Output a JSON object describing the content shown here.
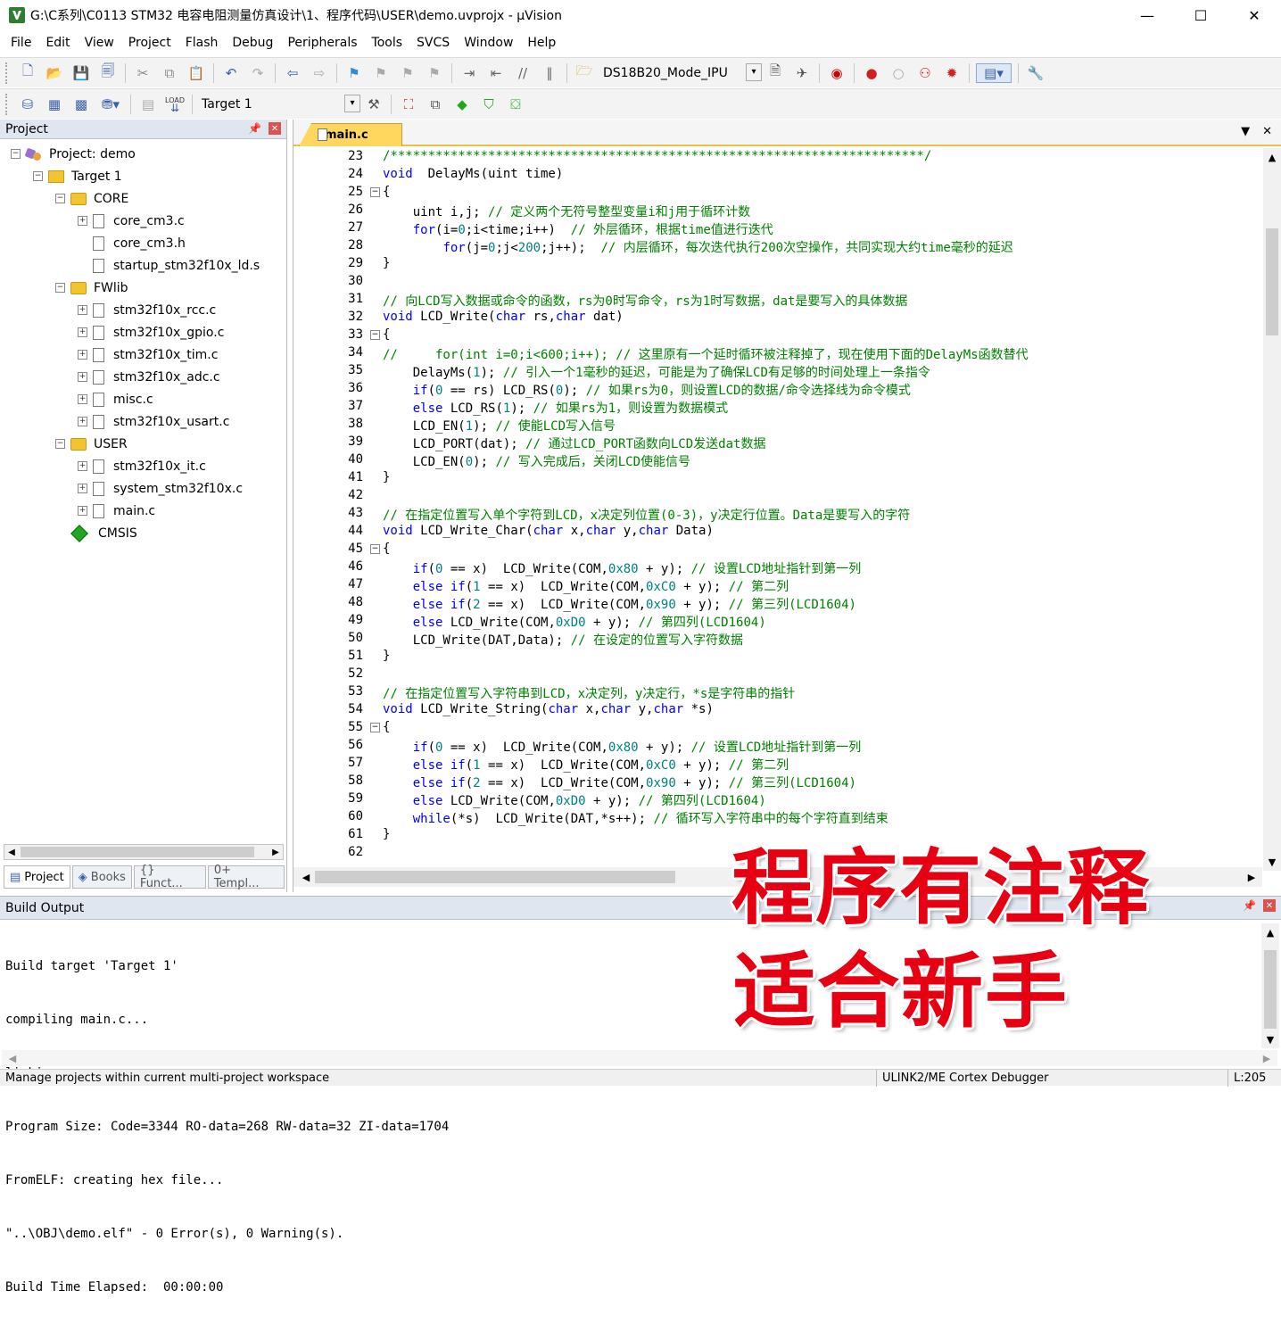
{
  "window": {
    "title": "G:\\C系列\\C0113 STM32 电容电阻测量仿真设计\\1、程序代码\\USER\\demo.uvprojx - µVision",
    "min": "—",
    "max": "☐",
    "close": "✕"
  },
  "menu": [
    "File",
    "Edit",
    "View",
    "Project",
    "Flash",
    "Debug",
    "Peripherals",
    "Tools",
    "SVCS",
    "Window",
    "Help"
  ],
  "toolbar": {
    "search_combo": "DS18B20_Mode_IPU",
    "target_combo": "Target 1",
    "load_label": "LOAD"
  },
  "project_panel": {
    "title": "Project",
    "root": "Project: demo",
    "target": "Target 1",
    "groups": [
      {
        "name": "CORE",
        "files": [
          "core_cm3.c",
          "core_cm3.h",
          "startup_stm32f10x_ld.s"
        ]
      },
      {
        "name": "FWlib",
        "files": [
          "stm32f10x_rcc.c",
          "stm32f10x_gpio.c",
          "stm32f10x_tim.c",
          "stm32f10x_adc.c",
          "misc.c",
          "stm32f10x_usart.c"
        ]
      },
      {
        "name": "USER",
        "files": [
          "stm32f10x_it.c",
          "system_stm32f10x.c",
          "main.c"
        ]
      }
    ],
    "cmsis": "CMSIS",
    "tabs": [
      "Project",
      "Books",
      "{} Funct...",
      "0+ Templ..."
    ]
  },
  "editor": {
    "tab": "main.c"
  },
  "code_lines": [
    {
      "n": "23",
      "fold": "",
      "parts": [
        [
          "cm",
          "/***********************************************************************/"
        ]
      ]
    },
    {
      "n": "24",
      "fold": "",
      "parts": [
        [
          "kw",
          "void"
        ],
        [
          "",
          "  DelayMs(uint time)"
        ]
      ]
    },
    {
      "n": "25",
      "fold": "-",
      "parts": [
        [
          "",
          "{"
        ]
      ]
    },
    {
      "n": "26",
      "fold": "",
      "parts": [
        [
          "",
          "    uint i,j; "
        ],
        [
          "cm",
          "// 定义两个无符号整型变量i和j用于循环计数"
        ]
      ]
    },
    {
      "n": "27",
      "fold": "",
      "parts": [
        [
          "",
          "    "
        ],
        [
          "kw",
          "for"
        ],
        [
          "",
          "(i="
        ],
        [
          "num",
          "0"
        ],
        [
          "",
          ";i<time;i++)  "
        ],
        [
          "cm",
          "// 外层循环，根据time值进行迭代"
        ]
      ]
    },
    {
      "n": "28",
      "fold": "",
      "parts": [
        [
          "",
          "        "
        ],
        [
          "kw",
          "for"
        ],
        [
          "",
          "(j="
        ],
        [
          "num",
          "0"
        ],
        [
          "",
          ";j<"
        ],
        [
          "num",
          "200"
        ],
        [
          "",
          ";j++);  "
        ],
        [
          "cm",
          "// 内层循环，每次迭代执行200次空操作，共同实现大约time毫秒的延迟"
        ]
      ]
    },
    {
      "n": "29",
      "fold": "",
      "parts": [
        [
          "",
          "}"
        ]
      ]
    },
    {
      "n": "30",
      "fold": "",
      "parts": [
        [
          "",
          ""
        ]
      ]
    },
    {
      "n": "31",
      "fold": "",
      "parts": [
        [
          "cm",
          "// 向LCD写入数据或命令的函数，rs为0时写命令，rs为1时写数据，dat是要写入的具体数据"
        ]
      ]
    },
    {
      "n": "32",
      "fold": "",
      "parts": [
        [
          "kw",
          "void"
        ],
        [
          "",
          " LCD_Write("
        ],
        [
          "kw",
          "char"
        ],
        [
          "",
          " rs,"
        ],
        [
          "kw",
          "char"
        ],
        [
          "",
          " dat)"
        ]
      ]
    },
    {
      "n": "33",
      "fold": "-",
      "parts": [
        [
          "",
          "{"
        ]
      ]
    },
    {
      "n": "34",
      "fold": "",
      "parts": [
        [
          "cm",
          "//     for(int i=0;i<600;i++); // 这里原有一个延时循环被注释掉了，现在使用下面的DelayMs函数替代"
        ]
      ]
    },
    {
      "n": "35",
      "fold": "",
      "parts": [
        [
          "",
          "    DelayMs("
        ],
        [
          "num",
          "1"
        ],
        [
          "",
          "); "
        ],
        [
          "cm",
          "// 引入一个1毫秒的延迟，可能是为了确保LCD有足够的时间处理上一条指令"
        ]
      ]
    },
    {
      "n": "36",
      "fold": "",
      "parts": [
        [
          "",
          "    "
        ],
        [
          "kw",
          "if"
        ],
        [
          "",
          "("
        ],
        [
          "num",
          "0"
        ],
        [
          "",
          " == rs) LCD_RS("
        ],
        [
          "num",
          "0"
        ],
        [
          "",
          "); "
        ],
        [
          "cm",
          "// 如果rs为0，则设置LCD的数据/命令选择线为命令模式"
        ]
      ]
    },
    {
      "n": "37",
      "fold": "",
      "parts": [
        [
          "",
          "    "
        ],
        [
          "kw",
          "else"
        ],
        [
          "",
          " LCD_RS("
        ],
        [
          "num",
          "1"
        ],
        [
          "",
          "); "
        ],
        [
          "cm",
          "// 如果rs为1，则设置为数据模式"
        ]
      ]
    },
    {
      "n": "38",
      "fold": "",
      "parts": [
        [
          "",
          "    LCD_EN("
        ],
        [
          "num",
          "1"
        ],
        [
          "",
          "); "
        ],
        [
          "cm",
          "// 使能LCD写入信号"
        ]
      ]
    },
    {
      "n": "39",
      "fold": "",
      "parts": [
        [
          "",
          "    LCD_PORT(dat); "
        ],
        [
          "cm",
          "// 通过LCD_PORT函数向LCD发送dat数据"
        ]
      ]
    },
    {
      "n": "40",
      "fold": "",
      "parts": [
        [
          "",
          "    LCD_EN("
        ],
        [
          "num",
          "0"
        ],
        [
          "",
          "); "
        ],
        [
          "cm",
          "// 写入完成后，关闭LCD使能信号"
        ]
      ]
    },
    {
      "n": "41",
      "fold": "",
      "parts": [
        [
          "",
          "}"
        ]
      ]
    },
    {
      "n": "42",
      "fold": "",
      "parts": [
        [
          "",
          ""
        ]
      ]
    },
    {
      "n": "43",
      "fold": "",
      "parts": [
        [
          "cm",
          "// 在指定位置写入单个字符到LCD，x决定列位置(0-3)，y决定行位置。Data是要写入的字符"
        ]
      ]
    },
    {
      "n": "44",
      "fold": "",
      "parts": [
        [
          "kw",
          "void"
        ],
        [
          "",
          " LCD_Write_Char("
        ],
        [
          "kw",
          "char"
        ],
        [
          "",
          " x,"
        ],
        [
          "kw",
          "char"
        ],
        [
          "",
          " y,"
        ],
        [
          "kw",
          "char"
        ],
        [
          "",
          " Data)"
        ]
      ]
    },
    {
      "n": "45",
      "fold": "-",
      "parts": [
        [
          "",
          "{"
        ]
      ]
    },
    {
      "n": "46",
      "fold": "",
      "parts": [
        [
          "",
          "    "
        ],
        [
          "kw",
          "if"
        ],
        [
          "",
          "("
        ],
        [
          "num",
          "0"
        ],
        [
          "",
          " == x)  LCD_Write(COM,"
        ],
        [
          "num",
          "0x80"
        ],
        [
          "",
          " + y); "
        ],
        [
          "cm",
          "// 设置LCD地址指针到第一列"
        ]
      ]
    },
    {
      "n": "47",
      "fold": "",
      "parts": [
        [
          "",
          "    "
        ],
        [
          "kw",
          "else if"
        ],
        [
          "",
          "("
        ],
        [
          "num",
          "1"
        ],
        [
          "",
          " == x)  LCD_Write(COM,"
        ],
        [
          "num",
          "0xC0"
        ],
        [
          "",
          " + y); "
        ],
        [
          "cm",
          "// 第二列"
        ]
      ]
    },
    {
      "n": "48",
      "fold": "",
      "parts": [
        [
          "",
          "    "
        ],
        [
          "kw",
          "else if"
        ],
        [
          "",
          "("
        ],
        [
          "num",
          "2"
        ],
        [
          "",
          " == x)  LCD_Write(COM,"
        ],
        [
          "num",
          "0x90"
        ],
        [
          "",
          " + y); "
        ],
        [
          "cm",
          "// 第三列(LCD1604)"
        ]
      ]
    },
    {
      "n": "49",
      "fold": "",
      "parts": [
        [
          "",
          "    "
        ],
        [
          "kw",
          "else"
        ],
        [
          "",
          " LCD_Write(COM,"
        ],
        [
          "num",
          "0xD0"
        ],
        [
          "",
          " + y); "
        ],
        [
          "cm",
          "// 第四列(LCD1604)"
        ]
      ]
    },
    {
      "n": "50",
      "fold": "",
      "parts": [
        [
          "",
          "    LCD_Write(DAT,Data); "
        ],
        [
          "cm",
          "// 在设定的位置写入字符数据"
        ]
      ]
    },
    {
      "n": "51",
      "fold": "",
      "parts": [
        [
          "",
          "}"
        ]
      ]
    },
    {
      "n": "52",
      "fold": "",
      "parts": [
        [
          "",
          ""
        ]
      ]
    },
    {
      "n": "53",
      "fold": "",
      "parts": [
        [
          "cm",
          "// 在指定位置写入字符串到LCD，x决定列，y决定行，*s是字符串的指针"
        ]
      ]
    },
    {
      "n": "54",
      "fold": "",
      "parts": [
        [
          "kw",
          "void"
        ],
        [
          "",
          " LCD_Write_String("
        ],
        [
          "kw",
          "char"
        ],
        [
          "",
          " x,"
        ],
        [
          "kw",
          "char"
        ],
        [
          "",
          " y,"
        ],
        [
          "kw",
          "char"
        ],
        [
          "",
          " *s)"
        ]
      ]
    },
    {
      "n": "55",
      "fold": "-",
      "parts": [
        [
          "",
          "{"
        ]
      ]
    },
    {
      "n": "56",
      "fold": "",
      "parts": [
        [
          "",
          "    "
        ],
        [
          "kw",
          "if"
        ],
        [
          "",
          "("
        ],
        [
          "num",
          "0"
        ],
        [
          "",
          " == x)  LCD_Write(COM,"
        ],
        [
          "num",
          "0x80"
        ],
        [
          "",
          " + y); "
        ],
        [
          "cm",
          "// 设置LCD地址指针到第一列"
        ]
      ]
    },
    {
      "n": "57",
      "fold": "",
      "parts": [
        [
          "",
          "    "
        ],
        [
          "kw",
          "else if"
        ],
        [
          "",
          "("
        ],
        [
          "num",
          "1"
        ],
        [
          "",
          " == x)  LCD_Write(COM,"
        ],
        [
          "num",
          "0xC0"
        ],
        [
          "",
          " + y); "
        ],
        [
          "cm",
          "// 第二列"
        ]
      ]
    },
    {
      "n": "58",
      "fold": "",
      "parts": [
        [
          "",
          "    "
        ],
        [
          "kw",
          "else if"
        ],
        [
          "",
          "("
        ],
        [
          "num",
          "2"
        ],
        [
          "",
          " == x)  LCD_Write(COM,"
        ],
        [
          "num",
          "0x90"
        ],
        [
          "",
          " + y); "
        ],
        [
          "cm",
          "// 第三列(LCD1604)"
        ]
      ]
    },
    {
      "n": "59",
      "fold": "",
      "parts": [
        [
          "",
          "    "
        ],
        [
          "kw",
          "else"
        ],
        [
          "",
          " LCD_Write(COM,"
        ],
        [
          "num",
          "0xD0"
        ],
        [
          "",
          " + y); "
        ],
        [
          "cm",
          "// 第四列(LCD1604)"
        ]
      ]
    },
    {
      "n": "60",
      "fold": "",
      "parts": [
        [
          "",
          "    "
        ],
        [
          "kw",
          "while"
        ],
        [
          "",
          "(*s)  LCD_Write(DAT,*s++); "
        ],
        [
          "cm",
          "// 循环写入字符串中的每个字符直到结束"
        ]
      ]
    },
    {
      "n": "61",
      "fold": "",
      "parts": [
        [
          "",
          "}"
        ]
      ]
    },
    {
      "n": "62",
      "fold": "",
      "parts": [
        [
          "",
          ""
        ]
      ]
    }
  ],
  "build_output": {
    "title": "Build Output",
    "lines": [
      "Build target 'Target 1'",
      "compiling main.c...",
      "linking...",
      "Program Size: Code=3344 RO-data=268 RW-data=32 ZI-data=1704",
      "FromELF: creating hex file...",
      "\"..\\OBJ\\demo.elf\" - 0 Error(s), 0 Warning(s).",
      "Build Time Elapsed:  00:00:00"
    ]
  },
  "statusbar": {
    "left": "Manage projects within current multi-project workspace",
    "debugger": "ULINK2/ME Cortex Debugger",
    "pos": "L:205"
  },
  "overlay": {
    "line1": "程序有注释",
    "line2": "适合新手"
  },
  "colors": {
    "keyword": "#0000ff",
    "comment": "#008000",
    "number": "#008080",
    "overlay": "#e60012"
  }
}
